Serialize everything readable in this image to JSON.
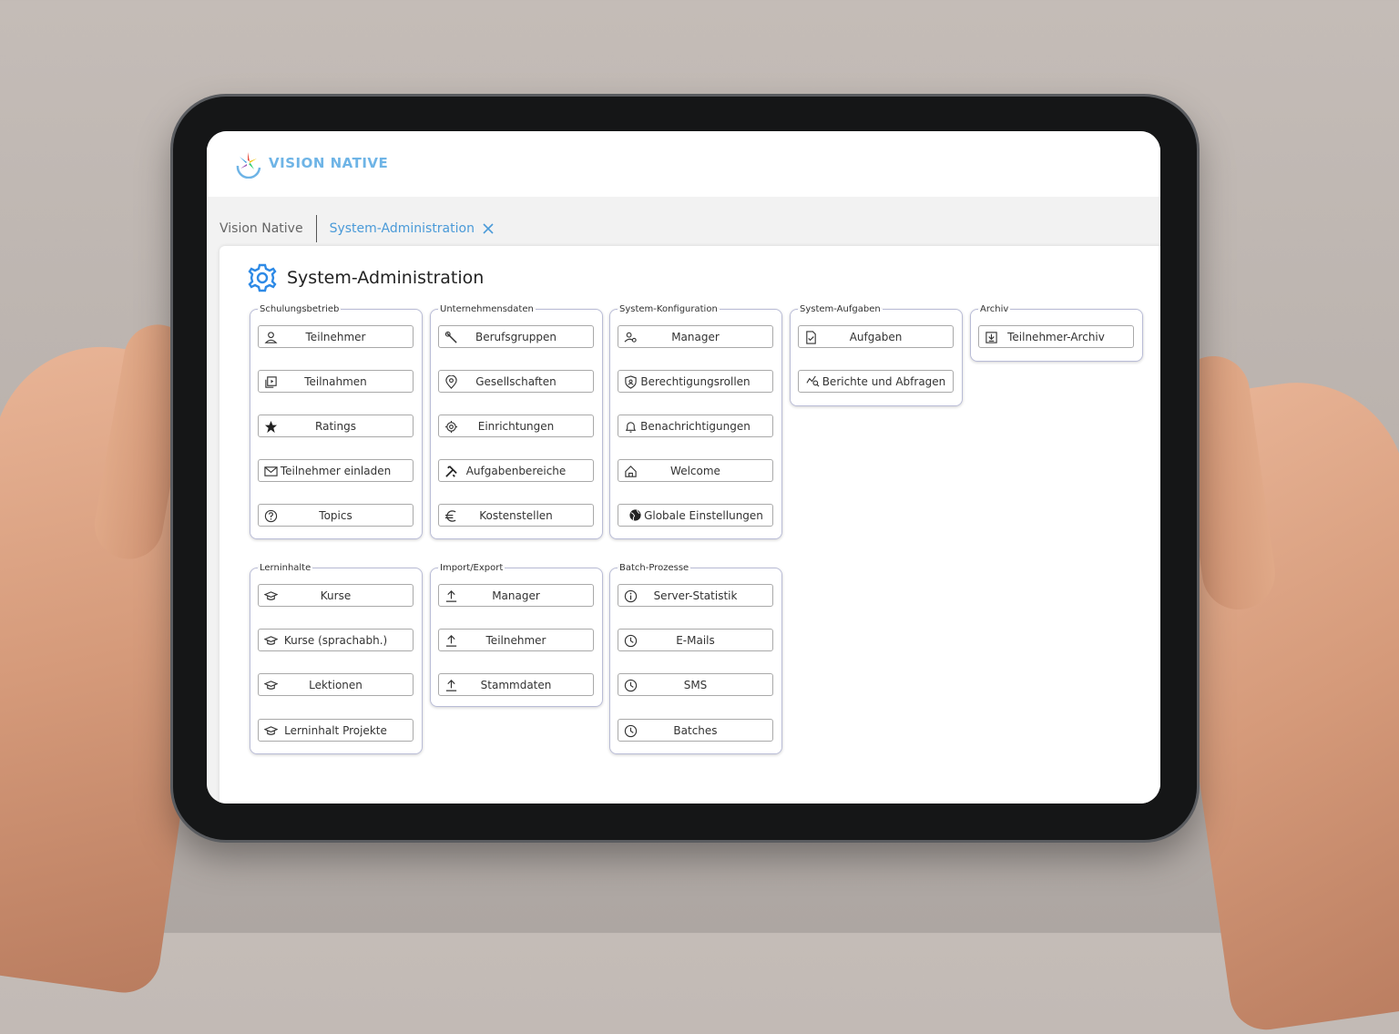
{
  "app": {
    "logo_text": "VISION NATIVE",
    "accent_color": "#4a9ad8"
  },
  "breadcrumb": {
    "home": "Vision Native",
    "active": "System-Administration"
  },
  "page": {
    "title": "System-Administration",
    "icon": "gear-icon"
  },
  "groups": {
    "schulungsbetrieb": {
      "title": "Schulungsbetrieb",
      "items": [
        {
          "label": "Teilnehmer",
          "icon": "user-icon"
        },
        {
          "label": "Teilnahmen",
          "icon": "video-library-icon"
        },
        {
          "label": "Ratings",
          "icon": "star-icon"
        },
        {
          "label": "Teilnehmer einladen",
          "icon": "mail-icon"
        },
        {
          "label": "Topics",
          "icon": "help-circle-icon"
        }
      ]
    },
    "unternehmensdaten": {
      "title": "Unternehmensdaten",
      "items": [
        {
          "label": "Berufsgruppen",
          "icon": "wrench-icon"
        },
        {
          "label": "Gesellschaften",
          "icon": "location-pin-icon"
        },
        {
          "label": "Einrichtungen",
          "icon": "target-icon"
        },
        {
          "label": "Aufgabenbereiche",
          "icon": "tools-icon"
        },
        {
          "label": "Kostenstellen",
          "icon": "euro-icon"
        }
      ]
    },
    "system_konfiguration": {
      "title": "System-Konfiguration",
      "items": [
        {
          "label": "Manager",
          "icon": "user-settings-icon"
        },
        {
          "label": "Berechtigungsrollen",
          "icon": "shield-icon"
        },
        {
          "label": "Benachrichtigungen",
          "icon": "bell-icon"
        },
        {
          "label": "Welcome",
          "icon": "home-icon"
        },
        {
          "label": "Globale Einstellungen",
          "icon": "globe-icon"
        }
      ]
    },
    "system_aufgaben": {
      "title": "System-Aufgaben",
      "items": [
        {
          "label": "Aufgaben",
          "icon": "task-file-icon"
        },
        {
          "label": "Berichte und Abfragen",
          "icon": "chart-search-icon"
        }
      ]
    },
    "archiv": {
      "title": "Archiv",
      "items": [
        {
          "label": "Teilnehmer-Archiv",
          "icon": "archive-icon"
        }
      ]
    },
    "lerninhalte": {
      "title": "Lerninhalte",
      "items": [
        {
          "label": "Kurse",
          "icon": "graduation-cap-icon"
        },
        {
          "label": "Kurse (sprachabh.)",
          "icon": "graduation-cap-icon"
        },
        {
          "label": "Lektionen",
          "icon": "graduation-cap-icon"
        },
        {
          "label": "Lerninhalt Projekte",
          "icon": "graduation-cap-icon"
        }
      ]
    },
    "import_export": {
      "title": "Import/Export",
      "items": [
        {
          "label": "Manager",
          "icon": "upload-icon"
        },
        {
          "label": "Teilnehmer",
          "icon": "upload-icon"
        },
        {
          "label": "Stammdaten",
          "icon": "upload-icon"
        }
      ]
    },
    "batch_prozesse": {
      "title": "Batch-Prozesse",
      "items": [
        {
          "label": "Server-Statistik",
          "icon": "info-icon"
        },
        {
          "label": "E-Mails",
          "icon": "clock-icon"
        },
        {
          "label": "SMS",
          "icon": "clock-icon"
        },
        {
          "label": "Batches",
          "icon": "clock-icon"
        }
      ]
    }
  }
}
